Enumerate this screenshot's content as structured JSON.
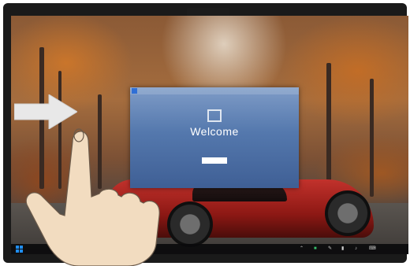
{
  "window": {
    "title": "",
    "heading": "Welcome",
    "subtitle": "",
    "button_label": ""
  },
  "taskbar": {
    "clock_time": "",
    "clock_date": ""
  },
  "icons": {
    "start": "windows-logo-icon",
    "welcome": "tablet-icon",
    "gesture_arrow": "arrow-right-icon",
    "gesture_hand": "pointing-hand-icon"
  },
  "colors": {
    "accent": "#1f8ef1",
    "window_gradient_top": "#7f9cc7",
    "window_gradient_bottom": "#3f5f95",
    "taskbar": "#0a0a0c"
  }
}
